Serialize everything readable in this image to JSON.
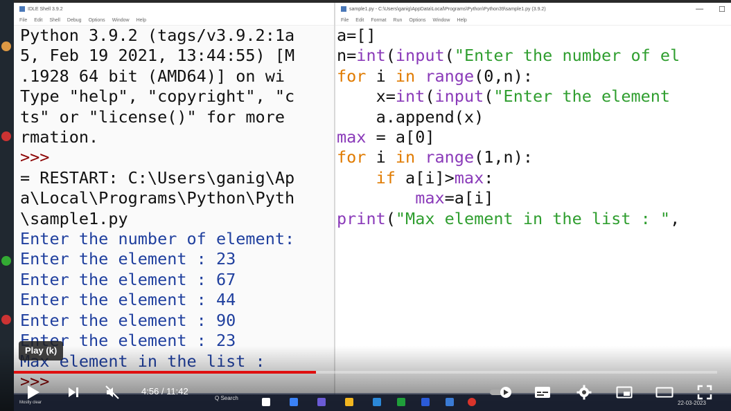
{
  "shell": {
    "title": "IDLE Shell 3.9.2",
    "menu": [
      "File",
      "Edit",
      "Shell",
      "Debug",
      "Options",
      "Window",
      "Help"
    ],
    "lines": [
      {
        "text": "Python 3.9.2 (tags/v3.9.2:1a",
        "cls": ""
      },
      {
        "text": "5, Feb 19 2021, 13:44:55) [M",
        "cls": ""
      },
      {
        "text": ".1928 64 bit (AMD64)] on wi",
        "cls": ""
      },
      {
        "text": "Type \"help\", \"copyright\", \"c",
        "cls": ""
      },
      {
        "text": "ts\" or \"license()\" for more",
        "cls": ""
      },
      {
        "text": "rmation.",
        "cls": ""
      },
      {
        "text": ">>>",
        "cls": "prompt"
      },
      {
        "text": "= RESTART: C:\\Users\\ganig\\Ap",
        "cls": ""
      },
      {
        "text": "a\\Local\\Programs\\Python\\Pyth",
        "cls": ""
      },
      {
        "text": "\\sample1.py",
        "cls": ""
      },
      {
        "text": "Enter the number of element:",
        "cls": "out"
      },
      {
        "text": "Enter the element : 23",
        "cls": "out"
      },
      {
        "text": "Enter the element : 67",
        "cls": "out"
      },
      {
        "text": "Enter the element : 44",
        "cls": "out"
      },
      {
        "text": "Enter the element : 90",
        "cls": "out"
      },
      {
        "text": "Enter the element : 23",
        "cls": "out"
      },
      {
        "text": "Max element in the list :",
        "cls": "out"
      },
      {
        "text": ">>>",
        "cls": "prompt"
      }
    ]
  },
  "editor": {
    "title": "sample1.py - C:\\Users\\ganig\\AppData\\Local\\Programs\\Python\\Python39\\sample1.py (3.9.2)",
    "menu": [
      "File",
      "Edit",
      "Format",
      "Run",
      "Options",
      "Window",
      "Help"
    ],
    "minimize": "—",
    "maximize": "☐",
    "lines": [
      [
        {
          "t": "a=[]",
          "c": ""
        }
      ],
      [
        {
          "t": "n=",
          "c": ""
        },
        {
          "t": "int",
          "c": "bi"
        },
        {
          "t": "(",
          "c": ""
        },
        {
          "t": "input",
          "c": "bi"
        },
        {
          "t": "(",
          "c": ""
        },
        {
          "t": "\"Enter the number of el",
          "c": "str"
        }
      ],
      [
        {
          "t": "for",
          "c": "kw"
        },
        {
          "t": " i ",
          "c": ""
        },
        {
          "t": "in",
          "c": "kw"
        },
        {
          "t": " ",
          "c": ""
        },
        {
          "t": "range",
          "c": "bi"
        },
        {
          "t": "(0,n):",
          "c": ""
        }
      ],
      [
        {
          "t": "    x=",
          "c": ""
        },
        {
          "t": "int",
          "c": "bi"
        },
        {
          "t": "(",
          "c": ""
        },
        {
          "t": "input",
          "c": "bi"
        },
        {
          "t": "(",
          "c": ""
        },
        {
          "t": "\"Enter the element",
          "c": "str"
        }
      ],
      [
        {
          "t": "    a.append(x)",
          "c": ""
        }
      ],
      [
        {
          "t": "max",
          "c": "bi"
        },
        {
          "t": " = a[0]",
          "c": ""
        }
      ],
      [
        {
          "t": "for",
          "c": "kw"
        },
        {
          "t": " i ",
          "c": ""
        },
        {
          "t": "in",
          "c": "kw"
        },
        {
          "t": " ",
          "c": ""
        },
        {
          "t": "range",
          "c": "bi"
        },
        {
          "t": "(1,n):",
          "c": ""
        }
      ],
      [
        {
          "t": "    ",
          "c": ""
        },
        {
          "t": "if",
          "c": "kw"
        },
        {
          "t": " a[i]>",
          "c": ""
        },
        {
          "t": "max",
          "c": "bi"
        },
        {
          "t": ":",
          "c": ""
        }
      ],
      [
        {
          "t": "        ",
          "c": ""
        },
        {
          "t": "max",
          "c": "bi"
        },
        {
          "t": "=a[i]",
          "c": ""
        }
      ],
      [
        {
          "t": "print",
          "c": "bi"
        },
        {
          "t": "(",
          "c": ""
        },
        {
          "t": "\"Max element in the list : \"",
          "c": "str"
        },
        {
          "t": ",",
          "c": ""
        }
      ]
    ]
  },
  "player": {
    "tooltip": "Play (k)",
    "time_current": "4:56",
    "time_total": "11:42",
    "progress": 0.43
  },
  "taskbar": {
    "search": "Q Search",
    "weather": "Mostly clear",
    "date": "22-03-2023"
  }
}
